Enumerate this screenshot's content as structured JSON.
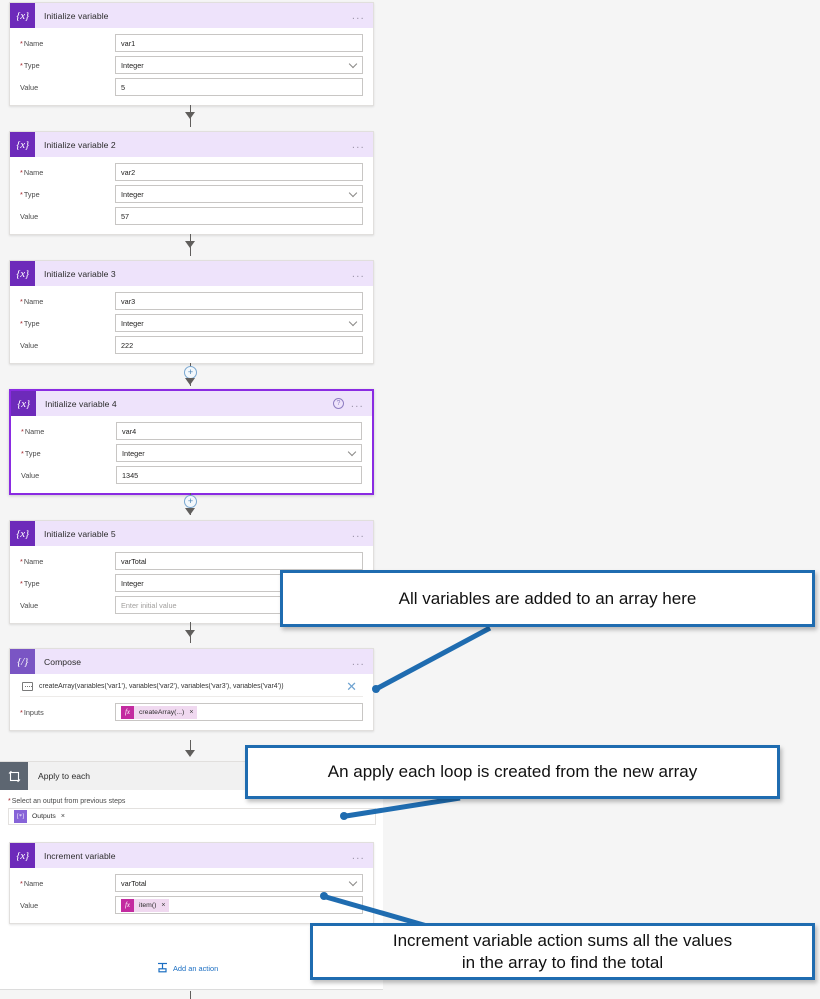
{
  "app": {
    "background": "#f5f5f5",
    "accent_purple": "#6d2aba",
    "callout_blue": "#1f6cb0"
  },
  "flow": {
    "cards": [
      {
        "id": "initialize-variable",
        "icon": "variable-icon",
        "icon_glyph": "{x}",
        "title": "Initialize variable",
        "selected": false,
        "menu": "...",
        "fields": [
          {
            "label": "Name",
            "required": true,
            "value": "var1",
            "control": "text"
          },
          {
            "label": "Type",
            "required": true,
            "value": "Integer",
            "control": "select"
          },
          {
            "label": "Value",
            "required": false,
            "value": "5",
            "control": "text"
          }
        ]
      },
      {
        "id": "initialize-variable-2",
        "icon": "variable-icon",
        "icon_glyph": "{x}",
        "title": "Initialize variable 2",
        "selected": false,
        "menu": "...",
        "fields": [
          {
            "label": "Name",
            "required": true,
            "value": "var2",
            "control": "text"
          },
          {
            "label": "Type",
            "required": true,
            "value": "Integer",
            "control": "select"
          },
          {
            "label": "Value",
            "required": false,
            "value": "57",
            "control": "text"
          }
        ]
      },
      {
        "id": "initialize-variable-3",
        "icon": "variable-icon",
        "icon_glyph": "{x}",
        "title": "Initialize variable 3",
        "selected": false,
        "menu": "...",
        "fields": [
          {
            "label": "Name",
            "required": true,
            "value": "var3",
            "control": "text"
          },
          {
            "label": "Type",
            "required": true,
            "value": "Integer",
            "control": "select"
          },
          {
            "label": "Value",
            "required": false,
            "value": "222",
            "control": "text"
          }
        ]
      },
      {
        "id": "initialize-variable-4",
        "icon": "variable-icon",
        "icon_glyph": "{x}",
        "title": "Initialize variable 4",
        "selected": true,
        "help": "?",
        "menu": "...",
        "fields": [
          {
            "label": "Name",
            "required": true,
            "value": "var4",
            "control": "text"
          },
          {
            "label": "Type",
            "required": true,
            "value": "Integer",
            "control": "select"
          },
          {
            "label": "Value",
            "required": false,
            "value": "1345",
            "control": "text"
          }
        ]
      },
      {
        "id": "initialize-variable-5",
        "icon": "variable-icon",
        "icon_glyph": "{x}",
        "title": "Initialize variable 5",
        "selected": false,
        "menu": "...",
        "fields": [
          {
            "label": "Name",
            "required": true,
            "value": "varTotal",
            "control": "text"
          },
          {
            "label": "Type",
            "required": true,
            "value": "Integer",
            "control": "select"
          },
          {
            "label": "Value",
            "required": false,
            "value": "",
            "placeholder": "Enter initial value",
            "control": "text"
          }
        ]
      }
    ],
    "compose": {
      "id": "compose",
      "icon": "compose-icon",
      "icon_glyph": "{/}",
      "title": "Compose",
      "menu": "...",
      "formula_tooltip": "createArray(variables('var1'), variables('var2'), variables('var3'), variables('var4'))",
      "close_label": "✕",
      "inputs_label": "Inputs",
      "inputs_required": true,
      "token": {
        "icon": "fx-icon",
        "icon_glyph": "fx",
        "text": "createArray(...)",
        "remove": "×"
      }
    },
    "apply_to_each": {
      "id": "apply-to-each",
      "icon": "loop-icon",
      "title": "Apply to each",
      "select_label": "Select an output from previous steps",
      "select_required": true,
      "token": {
        "icon": "outputs-icon",
        "icon_glyph": "[*]",
        "text": "Outputs",
        "remove": "×"
      },
      "increment": {
        "id": "increment-variable",
        "icon": "variable-icon",
        "icon_glyph": "{x}",
        "title": "Increment variable",
        "menu": "...",
        "name_label": "Name",
        "name_required": true,
        "name_value": "varTotal",
        "value_label": "Value",
        "value_required": false,
        "value_token": {
          "icon": "fx-icon",
          "icon_glyph": "fx",
          "text": "item()",
          "remove": "×"
        }
      },
      "add_action_label": "Add an action"
    },
    "add_step_plus": "+"
  },
  "callouts": [
    {
      "id": "callout-all-variables",
      "text": "All variables are added to an array here"
    },
    {
      "id": "callout-apply-each",
      "text": "An apply each loop is created from the new array"
    },
    {
      "id": "callout-increment",
      "text": "Increment variable action sums all the values\nin the array to find the total"
    }
  ]
}
